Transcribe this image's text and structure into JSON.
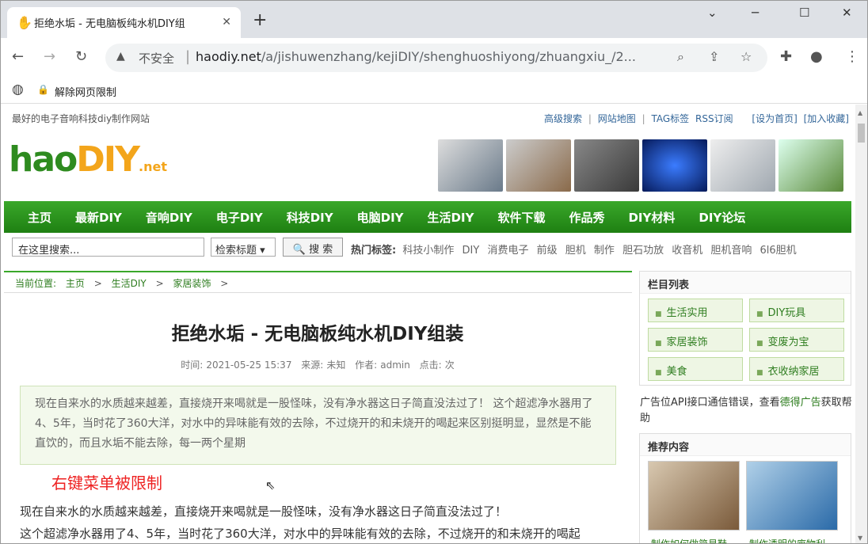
{
  "browser": {
    "tab_title": "拒绝水垢 - 无电脑板纯水机DIY组",
    "new_tab": "+",
    "insecure_label": "不安全",
    "url_host": "haodiy.net",
    "url_path": "/a/jishuwenzhang/kejiDIY/shenghuoshiyong/zhuangxiu_/2...",
    "bookmark_label": "解除网页限制"
  },
  "site": {
    "slogan": "最好的电子音响科技diy制作网站",
    "top_links": [
      "高级搜索",
      "|",
      "网站地图",
      "|",
      "TAG标签",
      "RSS订阅",
      "[设为首页]",
      "[加入收藏]"
    ],
    "logo_h": "hao",
    "logo_d": "DIY",
    "logo_net": ".net",
    "thumbs": [
      "#6a7a8a",
      "#8a6a4a",
      "#3a3a3a",
      "#1b3fa8",
      "#a0a8b0",
      "#5a8a3a"
    ],
    "nav": [
      "主页",
      "最新DIY",
      "音响DIY",
      "电子DIY",
      "科技DIY",
      "电脑DIY",
      "生活DIY",
      "软件下载",
      "作品秀",
      "DIY材料",
      "DIY论坛"
    ],
    "search_placeholder": "在这里搜索...",
    "search_select": "检索标题 ▾",
    "search_button": "🔍 搜 索",
    "hot_label": "热门标签:",
    "hot_tags": [
      "科技小制作",
      "DIY",
      "消费电子",
      "前级",
      "胆机",
      "制作",
      "胆石功放",
      "收音机",
      "胆机音响",
      "6l6胆机"
    ]
  },
  "breadcrumb": {
    "label": "当前位置:",
    "items": [
      "主页",
      ">",
      "生活DIY",
      ">",
      "家居装饰",
      ">"
    ]
  },
  "article": {
    "title": "拒绝水垢 - 无电脑板纯水机DIY组装",
    "meta": {
      "time_label": "时间:",
      "time": "2021-05-25 15:37",
      "source_label": "来源:",
      "source": "未知",
      "author_label": "作者:",
      "author": "admin",
      "clicks_label": "点击:",
      "clicks": "次"
    },
    "summary": "现在自来水的水质越来越差，直接烧开来喝就是一股怪味，没有净水器这日子简直没法过了！ 这个超滤净水器用了4、5年，当时花了360大洋，对水中的异味能有效的去除，不过烧开的和未烧开的喝起来区别挺明显，显然是不能直饮的，而且水垢不能去除，每一两个星期",
    "notice": "右键菜单被限制",
    "body_lines": [
      "现在自来水的水质越来越差，直接烧开来喝就是一股怪味，没有净水器这日子简直没法过了！",
      "这个超滤净水器用了4、5年，当时花了360大洋，对水中的异味能有效的去除，不过烧开的和未烧开的喝起"
    ]
  },
  "sidebar": {
    "categories_title": "栏目列表",
    "categories": [
      "生活实用",
      "DIY玩具",
      "家居装饰",
      "变废为宝",
      "美食",
      "衣收纳家居"
    ],
    "ad_text": "广告位API接口通信错误，查看",
    "ad_link": "德得广告",
    "ad_suffix": "获取帮助",
    "recommend_title": "推荐内容",
    "recommend_captions": [
      "制作如何做简易鞋",
      "制作透明的废物利"
    ]
  }
}
